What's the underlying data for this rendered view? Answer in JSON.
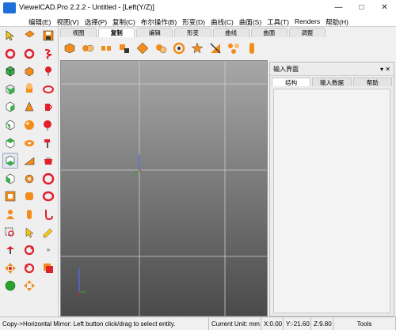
{
  "app": {
    "title": "ViewelCAD.Pro 2.2.2 - Untitled - [Left(Y/Z)]"
  },
  "menu": [
    "编辑(E)",
    "视图(V)",
    "选择(P)",
    "复制(C)",
    "布尔操作(B)",
    "形变(D)",
    "曲线(C)",
    "曲面(S)",
    "工具(T)",
    "Renders",
    "帮助(H)"
  ],
  "window_buttons": [
    "—",
    "□",
    "✕"
  ],
  "tabs": [
    "视图",
    "复制",
    "编辑",
    "形变",
    "曲线",
    "曲面",
    "调整"
  ],
  "active_tab": "复制",
  "panel": {
    "title": "输入界面",
    "tabs": [
      "结构",
      "输入数据",
      "帮助"
    ],
    "active_tab": "结构",
    "pin": "▾ ✕"
  },
  "status": {
    "message": "Copy->Horizontal Mirror: Left button click/drag to select entity.",
    "unit": "Current Unit:  mm",
    "x": "X:0.00",
    "y": "Y:-21.60",
    "z": "Z:9.80",
    "tools": "Tools"
  },
  "colors": {
    "orange": "#f28c1a",
    "red": "#e0202b",
    "green": "#2ca02c",
    "blue": "#1f6fd8",
    "viewport_top": "#a7a7a7",
    "viewport_bottom": "#4a4a4a"
  }
}
